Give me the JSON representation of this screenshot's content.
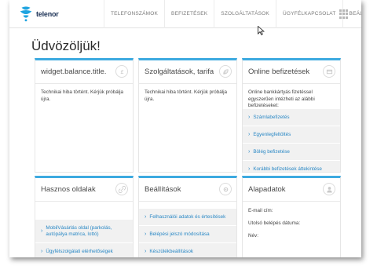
{
  "brand": {
    "name": "telenor",
    "accent": "#3daae0",
    "link_color": "#2a88c5"
  },
  "nav": {
    "items": [
      {
        "label": "TELEFONSZÁMOK"
      },
      {
        "label": "BEFIZETÉSEK"
      },
      {
        "label": "SZOLGÁLTATÁSOK"
      },
      {
        "label": "ÜGYFÉLKAPCSOLAT"
      },
      {
        "label": "BEÁLLÍTÁSOK"
      }
    ],
    "apps_icon": "grid-icon"
  },
  "page": {
    "title": "Üdvözöljük!"
  },
  "cards": {
    "balance": {
      "title": "widget.balance.title.",
      "icon": "currency-icon",
      "message": "Technikai hiba történt. Kérjük próbálja újra."
    },
    "services": {
      "title": "Szolgáltatások, tarifa",
      "icon": "leaf-icon",
      "message": "Technikai hiba történt. Kérjük próbálja újra."
    },
    "payments": {
      "title": "Online befizetések",
      "icon": "card-icon",
      "intro": "Online bankkártyás fizetéssel egyszerűen intézheti az alábbi befizetéseket:",
      "links": [
        {
          "label": "Számlabefizetés"
        },
        {
          "label": "Egyenlegfeltöltés"
        },
        {
          "label": "Bölég befizetése"
        },
        {
          "label": "Korábbi befizetések áttekintése"
        }
      ]
    },
    "useful": {
      "title": "Hasznos oldalak",
      "icon": "link-icon",
      "links": [
        {
          "label": "MobilVásárlás oldal (parkolás, autópálya matrica, lottó)"
        },
        {
          "label": "Ügyfélszolgálati elérhetőségek"
        }
      ]
    },
    "settings": {
      "title": "Beállítások",
      "icon": "gear-icon",
      "links": [
        {
          "label": "Felhasználói adatok és értesítések"
        },
        {
          "label": "Belépési jelszó módosítása"
        },
        {
          "label": "Készülékbeállítások"
        }
      ]
    },
    "basics": {
      "title": "Alapadatok",
      "icon": "user-icon",
      "fields": [
        {
          "label": "E-mail cím:"
        },
        {
          "label": "Utolsó belépés dátuma:"
        },
        {
          "label": "Név:"
        }
      ]
    }
  }
}
